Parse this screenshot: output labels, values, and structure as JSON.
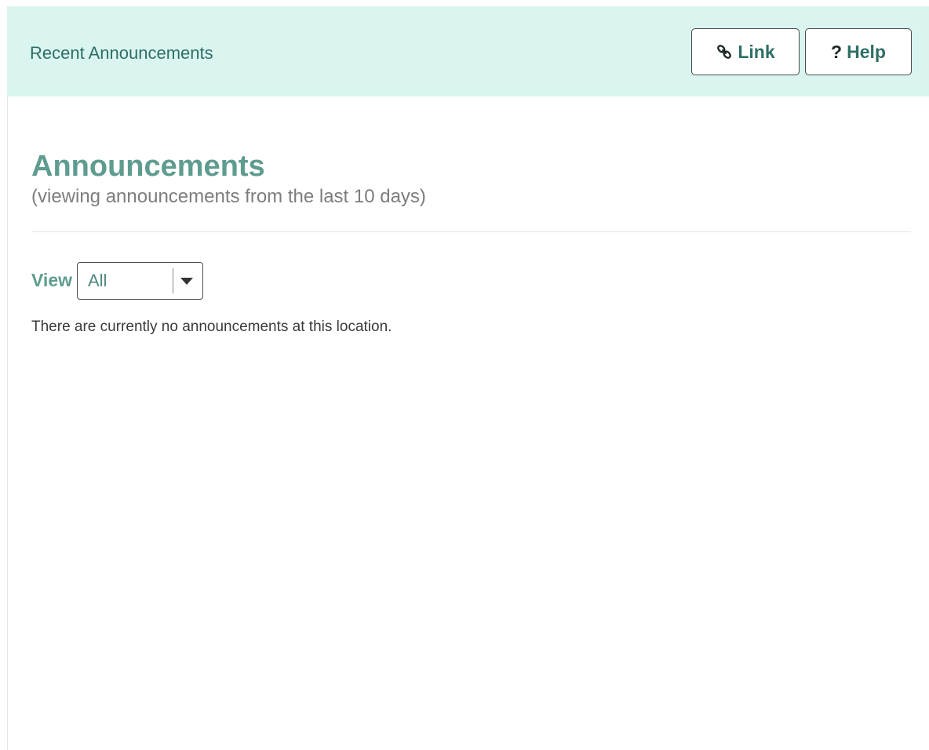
{
  "header": {
    "title": "Recent Announcements",
    "link_label": "Link",
    "help_label": "Help",
    "help_glyph": "?"
  },
  "main": {
    "title": "Announcements",
    "subtitle": "(viewing announcements from the last 10 days)",
    "view_label": "View",
    "view_selected": "All",
    "empty_message": "There are currently no announcements at this location."
  },
  "icons": {
    "link": "link-icon",
    "help": "question-icon",
    "dropdown": "caret-down-icon"
  },
  "colors": {
    "header_bg": "#daf5f0",
    "accent": "#5e9c8f",
    "header_text": "#2f6f66"
  }
}
